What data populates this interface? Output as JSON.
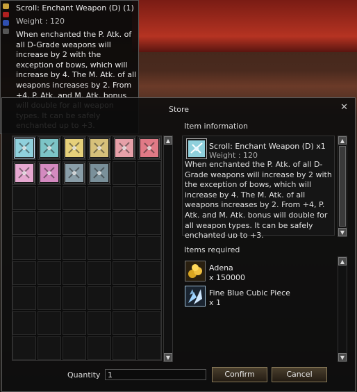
{
  "tooltip": {
    "title": "Scroll: Enchant Weapon (D) (1)",
    "weight": "Weight : 120",
    "description": "When enchanted the P. Atk. of all D-Grade weapons will increase by 2 with the exception of bows, which will increase by 4. The M. Atk. of all weapons increases by 2. From +4, P. Atk. and M. Atk. bonus will double for all weapon types.  It can be safely enchanted up to +3."
  },
  "window": {
    "title": "Store",
    "close_icon": "close-icon"
  },
  "grid": {
    "items": [
      {
        "name": "scroll-blue",
        "color": "#8fd0dc"
      },
      {
        "name": "scroll-teal",
        "color": "#7cc4c6"
      },
      {
        "name": "scroll-yellow",
        "color": "#e6d07a"
      },
      {
        "name": "scroll-tan",
        "color": "#d6c07a"
      },
      {
        "name": "scroll-pink",
        "color": "#e6a0a8"
      },
      {
        "name": "scroll-red",
        "color": "#e07a86"
      },
      {
        "name": "scroll-lightpink",
        "color": "#e6a8d0"
      },
      {
        "name": "scroll-magenta",
        "color": "#d48ac0"
      },
      {
        "name": "scroll-gray",
        "color": "#8a9ea8"
      },
      {
        "name": "scroll-slate",
        "color": "#7a909a"
      }
    ]
  },
  "info": {
    "heading": "Item information",
    "name": "Scroll: Enchant Weapon (D)",
    "count": "x1",
    "weight": "Weight : 120",
    "description": "When enchanted the P. Atk. of all D-Grade weapons will increase by 2 with the exception of bows, which will increase by 4. The M. Atk. of all weapons increases by 2. From +4, P. Atk. and M. Atk. bonus will double for all weapon types.  It can be safely enchanted up to +3."
  },
  "required": {
    "heading": "Items required",
    "items": [
      {
        "name": "Adena",
        "qty": "x 150000",
        "icon": "adena-icon"
      },
      {
        "name": "Fine Blue Cubic Piece",
        "qty": "x 1",
        "icon": "blue-cubic-piece-icon"
      }
    ]
  },
  "quantity": {
    "label": "Quantity",
    "value": "1"
  },
  "buttons": {
    "confirm": "Confirm",
    "cancel": "Cancel"
  }
}
